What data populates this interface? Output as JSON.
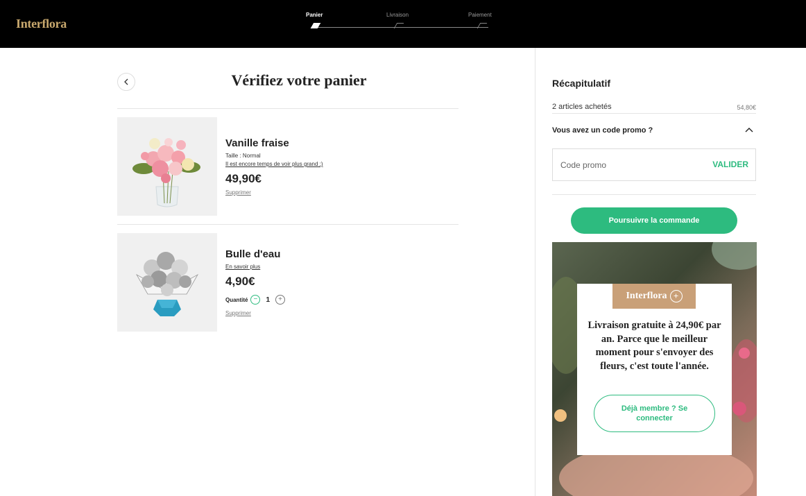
{
  "header": {
    "logo": "Interflora",
    "steps": [
      {
        "label": "Panier",
        "active": true
      },
      {
        "label": "Livraison",
        "active": false
      },
      {
        "label": "Paiement",
        "active": false
      }
    ]
  },
  "main": {
    "title": "Vérifiez votre panier",
    "products": [
      {
        "name": "Vanille fraise",
        "size": "Taille : Normal",
        "link": "Il est encore temps de voir plus grand ;)",
        "price": "49,90€",
        "delete": "Supprimer"
      },
      {
        "name": "Bulle d'eau",
        "link": "En savoir plus",
        "price": "4,90€",
        "quantity_label": "Quantité",
        "quantity": "1",
        "minus": "−",
        "plus": "+",
        "delete": "Supprimer"
      }
    ]
  },
  "summary": {
    "title": "Récapitulatif",
    "articles_label": "2 articles achetés",
    "articles_total": "54,80€",
    "promo_question": "Vous avez un code promo ?",
    "promo_placeholder": "Code promo",
    "promo_validate": "VALIDER",
    "continue": "Poursuivre la commande"
  },
  "banner": {
    "badge": "Interflora",
    "badge_plus": "+",
    "text": "Livraison gratuite à 24,90€ par an. Parce que le meilleur moment pour s'envoyer des fleurs, c'est toute l'année.",
    "button": "Déjà membre ? Se connecter"
  },
  "colors": {
    "accent": "#2dbb7f",
    "gold": "#c9a96e",
    "header_bg": "#000000"
  }
}
